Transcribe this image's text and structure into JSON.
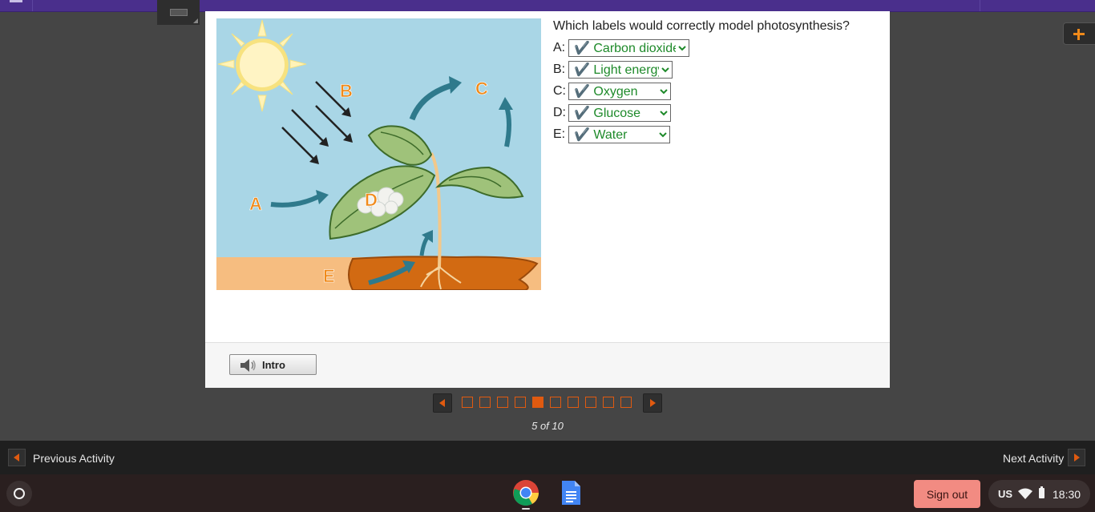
{
  "question": {
    "prompt": "Which labels would correctly model photosynthesis?",
    "answers": [
      {
        "letter": "A:",
        "selected": "✔️ Carbon dioxide"
      },
      {
        "letter": "B:",
        "selected": "✔️ Light energy"
      },
      {
        "letter": "C:",
        "selected": "✔️ Oxygen"
      },
      {
        "letter": "D:",
        "selected": "✔️ Glucose"
      },
      {
        "letter": "E:",
        "selected": "✔️ Water"
      }
    ]
  },
  "diagram": {
    "labels": {
      "a": "A",
      "b": "B",
      "c": "C",
      "d": "D",
      "e": "E"
    },
    "colors": {
      "sky": "#a9d6e6",
      "soil": "#f6bd80",
      "mud": "#d26a12",
      "arrow": "#2f7a8c",
      "label": "#f08a1a",
      "leaf": "#9fc27a"
    }
  },
  "footer": {
    "intro_label": "Intro"
  },
  "pager": {
    "total": 10,
    "current": 5,
    "count_text": "5 of 10"
  },
  "activity_nav": {
    "previous_label": "Previous Activity",
    "next_label": "Next Activity"
  },
  "shelf": {
    "signout_label": "Sign out",
    "ime": "US",
    "time": "18:30",
    "apps": [
      "chrome-icon",
      "docs-icon"
    ]
  },
  "theme": {
    "accent": "#e05a10",
    "topbar": "#4a2f8c",
    "check_green": "#1e8a2a"
  }
}
